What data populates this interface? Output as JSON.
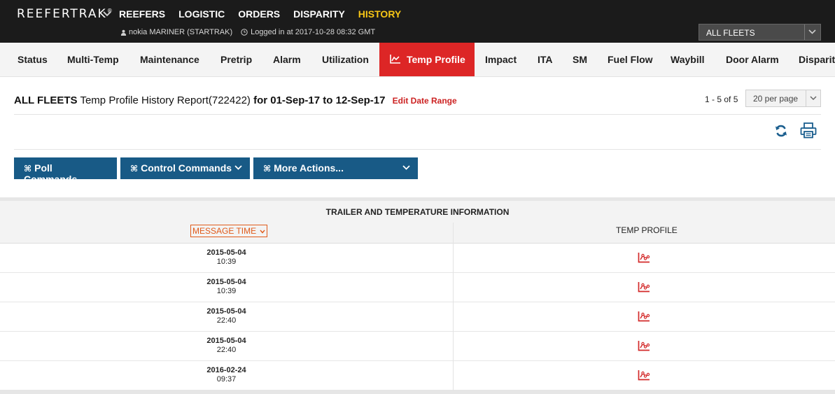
{
  "app": {
    "brand": "REEFERTRAK",
    "brand_mark": "®",
    "nav": [
      "REEFERS",
      "LOGISTIC",
      "ORDERS",
      "DISPARITY",
      "HISTORY"
    ],
    "active_nav": "HISTORY",
    "user": "nokia MARINER (STARTRAK)",
    "login_info": "Logged in at 2017-10-28 08:32 GMT",
    "fleet_selector": "ALL FLEETS",
    "colors": {
      "topbar": "#1b1b1b",
      "active_nav": "#f7c616",
      "active_tab": "#dd2626",
      "button": "#185a86",
      "link": "#cc2222",
      "sort_header": "#e05a1a"
    }
  },
  "tabs": [
    "Status",
    "Multi-Temp",
    "Maintenance",
    "Pretrip",
    "Alarm",
    "Utilization",
    "Temp Profile",
    "Impact",
    "ITA",
    "SM",
    "Fuel Flow",
    "Waybill",
    "Door Alarm",
    "Disparity"
  ],
  "active_tab": "Temp Profile",
  "report": {
    "fleet": "ALL FLEETS",
    "name": "Temp Profile History Report(722422)",
    "range": "for 01-Sep-17 to 12-Sep-17",
    "edit_link": "Edit Date Range",
    "pager": "1 - 5 of 5",
    "per_page": "20 per page"
  },
  "actions": {
    "poll": "Poll Commands",
    "control": "Control Commands",
    "more": "More Actions...",
    "glyph": "⌘"
  },
  "table": {
    "caption": "TRAILER AND TEMPERATURE INFORMATION",
    "col_message_time": "MESSAGE TIME",
    "col_temp_profile": "TEMP PROFILE",
    "rows": [
      {
        "date": "2015-05-04",
        "time": "10:39"
      },
      {
        "date": "2015-05-04",
        "time": "10:39"
      },
      {
        "date": "2015-05-04",
        "time": "22:40"
      },
      {
        "date": "2015-05-04",
        "time": "22:40"
      },
      {
        "date": "2016-02-24",
        "time": "09:37"
      }
    ]
  },
  "icons": [
    "user-icon",
    "clock-icon",
    "chevron-down-icon",
    "temp-profile-chart-icon",
    "refresh-icon",
    "print-icon"
  ]
}
